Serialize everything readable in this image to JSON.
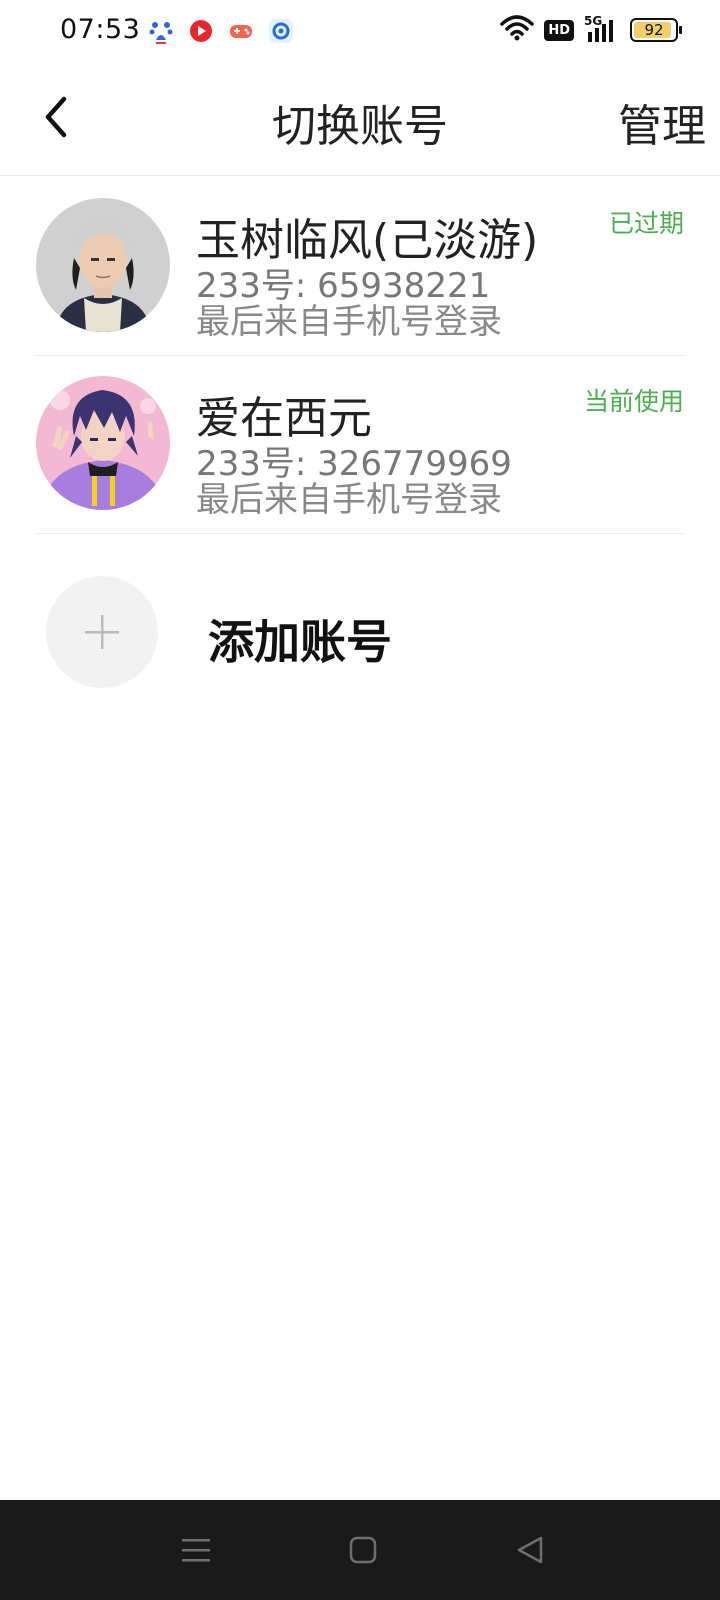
{
  "status_bar": {
    "time": "07:53",
    "notification_icons": [
      "baidu-icon",
      "video-app-icon",
      "game-app-icon",
      "browser-app-icon"
    ],
    "hd_label": "HD",
    "network_label": "5G",
    "battery_level": 92
  },
  "header": {
    "title": "切换账号",
    "manage_label": "管理"
  },
  "accounts": [
    {
      "name": "玉树临风(己淡游)",
      "id_line": "233号: 65938221",
      "login_line": "最后来自手机号登录",
      "status": "已过期",
      "avatar": "avatar-silver-hair"
    },
    {
      "name": "爱在西元",
      "id_line": "233号: 326779969",
      "login_line": "最后来自手机号登录",
      "status": "当前使用",
      "avatar": "avatar-purple-hoodie"
    }
  ],
  "add_account": {
    "label": "添加账号"
  },
  "colors": {
    "status_green": "#4caf50",
    "nav_bar_bg": "#1a1a1a",
    "battery_fill": "#f0cf6a"
  }
}
